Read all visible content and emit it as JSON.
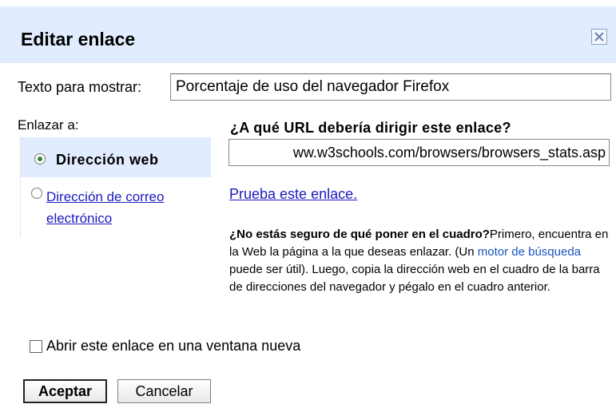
{
  "dialog": {
    "title": "Editar enlace",
    "close_icon": "close-icon"
  },
  "display_text": {
    "label": "Texto para mostrar:",
    "value": "Porcentaje de uso del navegador Firefox"
  },
  "link_to": {
    "label": "Enlazar a:",
    "options": [
      {
        "label": "Dirección web",
        "selected": true
      },
      {
        "label": "Dirección de correo electrónico",
        "selected": false
      }
    ]
  },
  "url_section": {
    "question": "¿A qué URL debería dirigir este enlace?",
    "value": "ww.w3schools.com/browsers/browsers_stats.asp",
    "test_link": "Prueba este enlace.",
    "help_title": "¿No estás seguro de qué poner en el cuadro?",
    "help_text_1": "Primero, encuentra en la Web la página a la que deseas enlazar. (Un ",
    "help_search_link": "motor de búsqueda",
    "help_text_2": " puede ser útil). Luego, copia la dirección web en el cuadro de la barra de direcciones del navegador y pégalo en el cuadro anterior."
  },
  "new_window": {
    "label": "Abrir este enlace en una ventana nueva",
    "checked": false
  },
  "buttons": {
    "ok": "Aceptar",
    "cancel": "Cancelar"
  },
  "colors": {
    "title_bar": "#e1ecfe",
    "link": "#1a1ac0",
    "selected_option_bg": "#e1ecfe"
  }
}
